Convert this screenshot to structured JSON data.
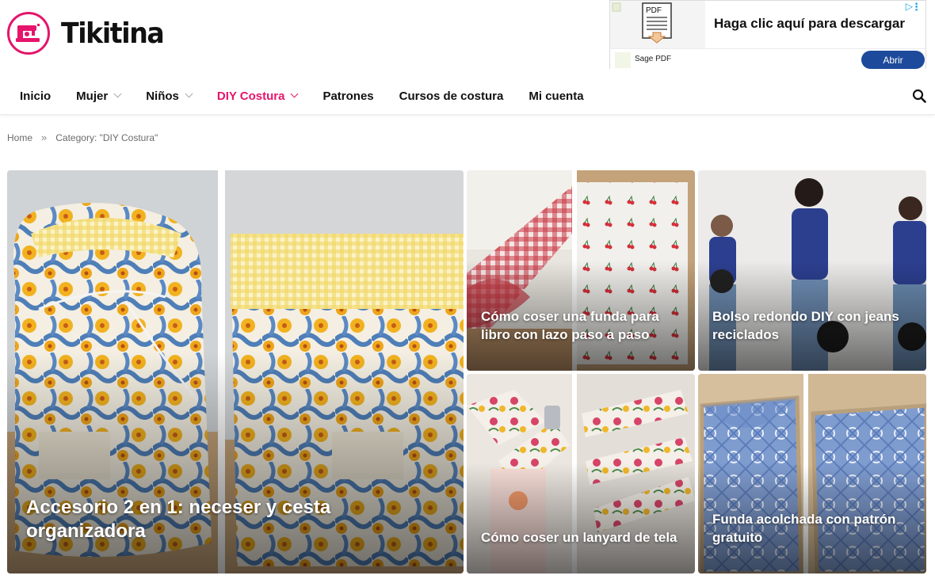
{
  "site": {
    "name": "Tikitina"
  },
  "ad": {
    "icon": "pdf-document-icon",
    "headline": "Haga clic aquí para descargar",
    "brand": "Sage PDF",
    "cta": "Abrir",
    "button_color": "#1d4a9b"
  },
  "nav": {
    "items": [
      {
        "label": "Inicio"
      },
      {
        "label": "Mujer"
      },
      {
        "label": "Niños"
      },
      {
        "label": "DIY Costura"
      },
      {
        "label": "Patrones"
      },
      {
        "label": "Cursos de costura"
      },
      {
        "label": "Mi cuenta"
      }
    ],
    "active_color": "#e5156b",
    "search_icon": "search-icon"
  },
  "breadcrumb": {
    "home": "Home",
    "separator": "»",
    "current": "Category: \"DIY Costura\""
  },
  "posts": [
    {
      "title": "Accesorio 2 en 1: neceser y cesta organizadora"
    },
    {
      "title": "Cómo coser una funda para libro con lazo paso a paso"
    },
    {
      "title": "Bolso redondo DIY con jeans reciclados"
    },
    {
      "title": "Cómo coser un lanyard de tela"
    },
    {
      "title": "Funda acolchada con patrón gratuito"
    }
  ],
  "colors": {
    "brand_pink": "#e5156b",
    "text": "#111111"
  }
}
